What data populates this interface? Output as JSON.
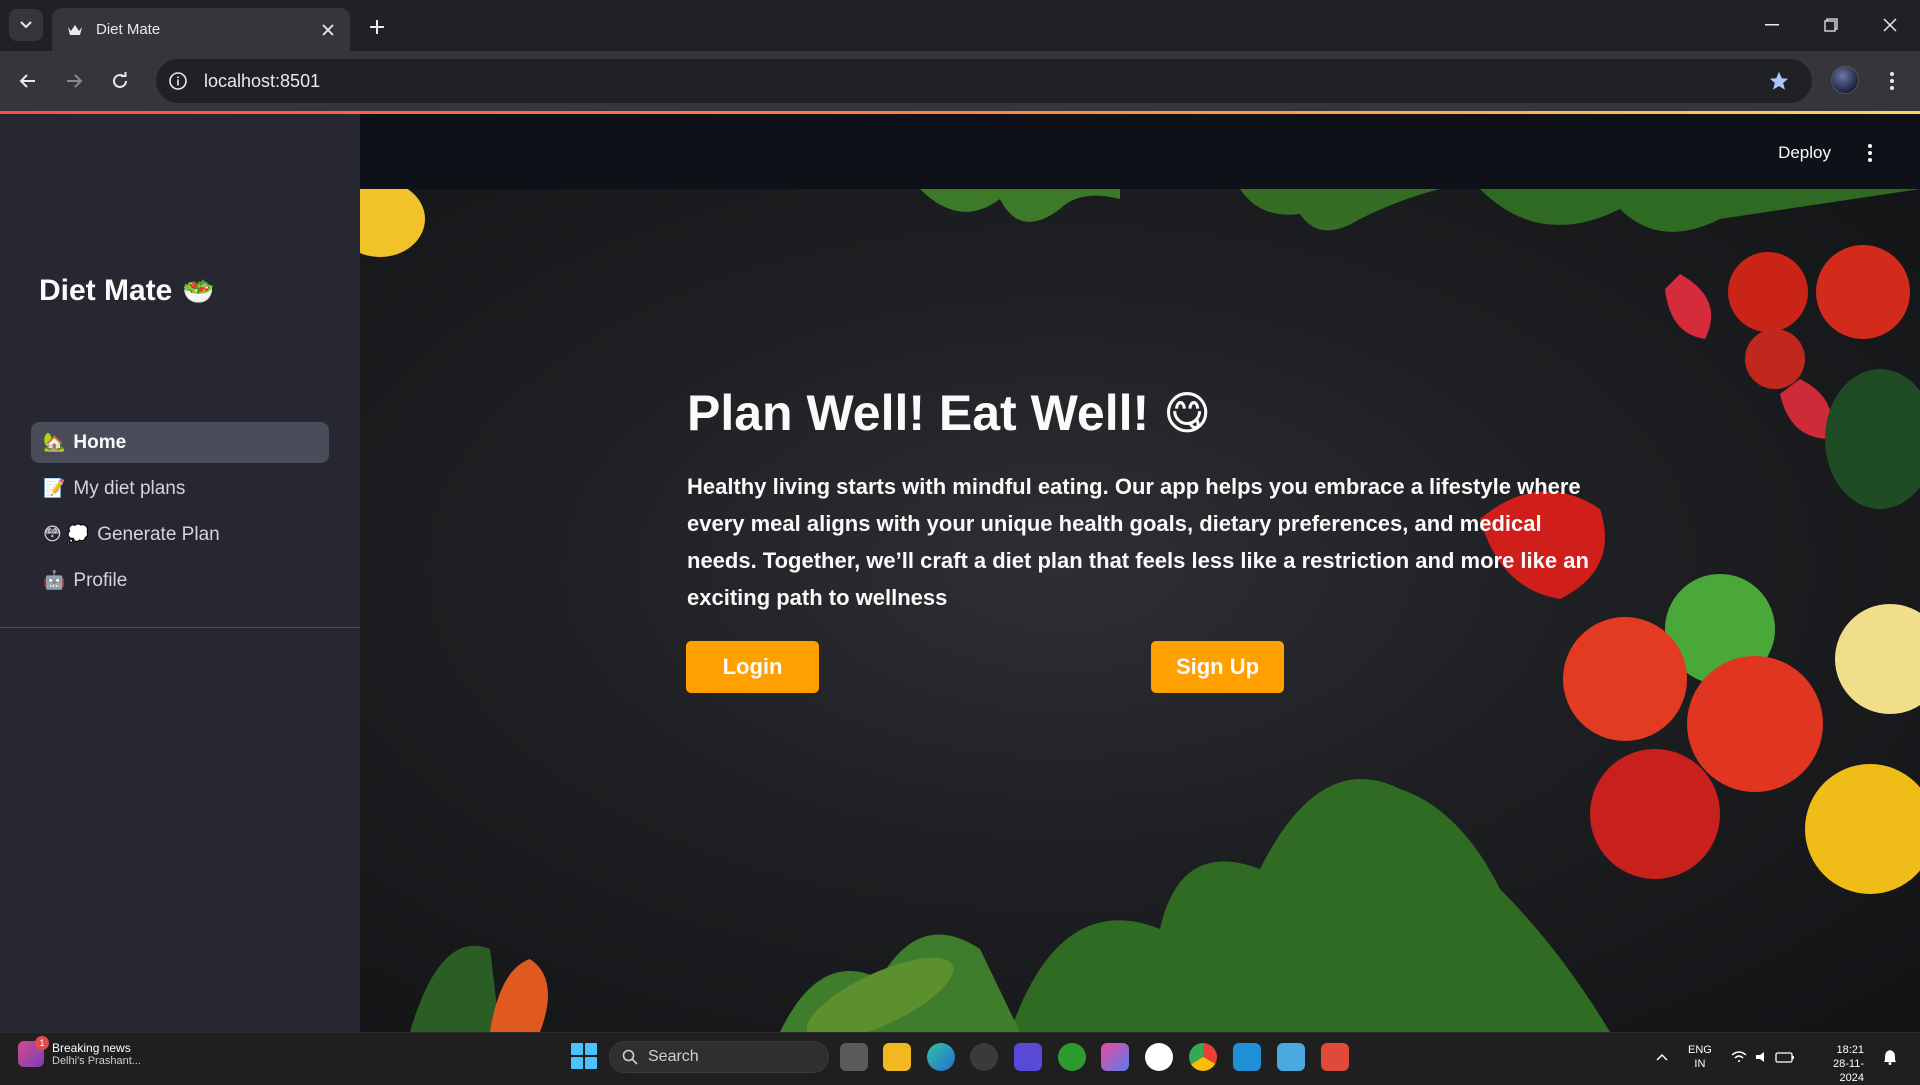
{
  "browser": {
    "tab_title": "Diet Mate",
    "url": "localhost:8501"
  },
  "sidebar": {
    "app_title": "Diet Mate",
    "app_emoji": "🥗",
    "items": [
      {
        "emoji": "🏡",
        "label": "Home",
        "active": true
      },
      {
        "emoji": "📝",
        "label": "My diet plans",
        "active": false
      },
      {
        "emoji": "😳 💭",
        "label": "Generate Plan",
        "active": false
      },
      {
        "emoji": "🤖",
        "label": "Profile",
        "active": false
      }
    ]
  },
  "header": {
    "deploy_label": "Deploy"
  },
  "hero": {
    "headline": "Plan Well! Eat Well!",
    "headline_emoji": "😋",
    "body": "Healthy living starts with mindful eating. Our app helps you embrace a lifestyle where every meal aligns with your unique health goals, dietary preferences, and medical needs. Together, we’ll craft a diet plan that feels less like a restriction and more like an exciting path to wellness",
    "login_label": "Login",
    "signup_label": "Sign Up"
  },
  "colors": {
    "accent": "#ff9f00",
    "sidebar_bg": "#262730",
    "main_bg": "#0e1117"
  },
  "taskbar": {
    "news_title": "Breaking news",
    "news_sub": "Delhi's Prashant...",
    "news_badge": "1",
    "search_label": "Search",
    "lang_top": "ENG",
    "lang_bottom": "IN",
    "time": "18:21",
    "date": "28-11-2024"
  }
}
